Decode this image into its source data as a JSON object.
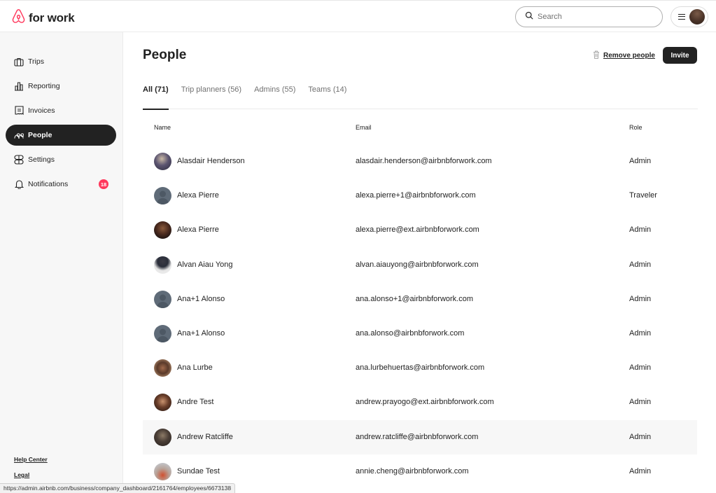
{
  "header": {
    "logo_text": "for work",
    "brand_color": "#ff385c",
    "search_placeholder": "Search"
  },
  "sidebar": {
    "items": [
      {
        "label": "Trips",
        "icon": "briefcase-icon"
      },
      {
        "label": "Reporting",
        "icon": "bar-chart-icon"
      },
      {
        "label": "Invoices",
        "icon": "receipt-icon"
      },
      {
        "label": "People",
        "icon": "people-icon",
        "active": true
      },
      {
        "label": "Settings",
        "icon": "toggles-icon"
      },
      {
        "label": "Notifications",
        "icon": "bell-icon",
        "badge": "18"
      }
    ],
    "footer_links": [
      "Help Center",
      "Legal"
    ]
  },
  "main": {
    "title": "People",
    "remove_label": "Remove people",
    "invite_label": "Invite",
    "tabs": [
      {
        "label": "All (71)",
        "active": true
      },
      {
        "label": "Trip planners (56)"
      },
      {
        "label": "Admins (55)"
      },
      {
        "label": "Teams (14)"
      }
    ],
    "columns": [
      "Name",
      "Email",
      "Role"
    ],
    "rows": [
      {
        "name": "Alasdair Henderson",
        "email": "alasdair.henderson@airbnbforwork.com",
        "role": "Admin",
        "avatar": "photo"
      },
      {
        "name": "Alexa Pierre",
        "email": "alexa.pierre+1@airbnbforwork.com",
        "role": "Traveler",
        "avatar": "placeholder"
      },
      {
        "name": "Alexa Pierre",
        "email": "alexa.pierre@ext.airbnbforwork.com",
        "role": "Admin",
        "avatar": "photo"
      },
      {
        "name": "Alvan Aiau Yong",
        "email": "alvan.aiauyong@airbnbforwork.com",
        "role": "Admin",
        "avatar": "photo"
      },
      {
        "name": "Ana+1 Alonso",
        "email": "ana.alonso+1@airbnbforwork.com",
        "role": "Admin",
        "avatar": "placeholder"
      },
      {
        "name": "Ana+1 Alonso",
        "email": "ana.alonso@airbnbforwork.com",
        "role": "Admin",
        "avatar": "placeholder"
      },
      {
        "name": "Ana Lurbe",
        "email": "ana.lurbehuertas@airbnbforwork.com",
        "role": "Admin",
        "avatar": "photo"
      },
      {
        "name": "Andre Test",
        "email": "andrew.prayogo@ext.airbnbforwork.com",
        "role": "Admin",
        "avatar": "photo"
      },
      {
        "name": "Andrew Ratcliffe",
        "email": "andrew.ratcliffe@airbnbforwork.com",
        "role": "Admin",
        "avatar": "photo",
        "hovered": true
      },
      {
        "name": "Sundae Test",
        "email": "annie.cheng@airbnbforwork.com",
        "role": "Admin",
        "avatar": "photo"
      }
    ]
  },
  "status_bar_url": "https://admin.airbnb.com/business/company_dashboard/2161764/employees/6673138"
}
